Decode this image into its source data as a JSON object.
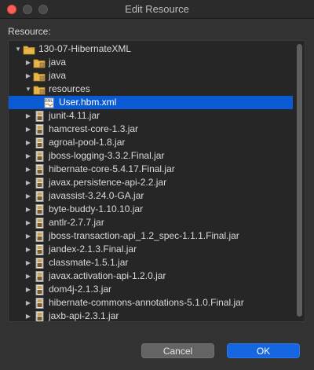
{
  "window": {
    "title": "Edit Resource"
  },
  "resource_label": "Resource:",
  "tree": [
    {
      "label": "130-07-HibernateXML",
      "icon": "project-folder-icon",
      "expanded": true,
      "depth": 0
    },
    {
      "label": "java",
      "icon": "package-folder-icon",
      "expanded": false,
      "depth": 1
    },
    {
      "label": "java",
      "icon": "package-folder-icon",
      "expanded": false,
      "depth": 1
    },
    {
      "label": "resources",
      "icon": "package-folder-icon",
      "expanded": true,
      "depth": 1
    },
    {
      "label": "User.hbm.xml",
      "icon": "xml-file-icon",
      "selected": true,
      "depth": 2
    },
    {
      "label": "junit-4.11.jar",
      "icon": "jar-file-icon",
      "depth": 1
    },
    {
      "label": "hamcrest-core-1.3.jar",
      "icon": "jar-file-icon",
      "depth": 1
    },
    {
      "label": "agroal-pool-1.8.jar",
      "icon": "jar-file-icon",
      "depth": 1
    },
    {
      "label": "jboss-logging-3.3.2.Final.jar",
      "icon": "jar-file-icon",
      "depth": 1
    },
    {
      "label": "hibernate-core-5.4.17.Final.jar",
      "icon": "jar-file-icon",
      "depth": 1
    },
    {
      "label": "javax.persistence-api-2.2.jar",
      "icon": "jar-file-icon",
      "depth": 1
    },
    {
      "label": "javassist-3.24.0-GA.jar",
      "icon": "jar-file-icon",
      "depth": 1
    },
    {
      "label": "byte-buddy-1.10.10.jar",
      "icon": "jar-file-icon",
      "depth": 1
    },
    {
      "label": "antlr-2.7.7.jar",
      "icon": "jar-file-icon",
      "depth": 1
    },
    {
      "label": "jboss-transaction-api_1.2_spec-1.1.1.Final.jar",
      "icon": "jar-file-icon",
      "depth": 1
    },
    {
      "label": "jandex-2.1.3.Final.jar",
      "icon": "jar-file-icon",
      "depth": 1
    },
    {
      "label": "classmate-1.5.1.jar",
      "icon": "jar-file-icon",
      "depth": 1
    },
    {
      "label": "javax.activation-api-1.2.0.jar",
      "icon": "jar-file-icon",
      "depth": 1
    },
    {
      "label": "dom4j-2.1.3.jar",
      "icon": "jar-file-icon",
      "depth": 1
    },
    {
      "label": "hibernate-commons-annotations-5.1.0.Final.jar",
      "icon": "jar-file-icon",
      "depth": 1
    },
    {
      "label": "jaxb-api-2.3.1.jar",
      "icon": "jar-file-icon",
      "depth": 1
    }
  ],
  "buttons": {
    "cancel": "Cancel",
    "ok": "OK"
  },
  "colors": {
    "selection": "#0a5bd3",
    "ok_button": "#1566e0",
    "background": "#323232"
  }
}
